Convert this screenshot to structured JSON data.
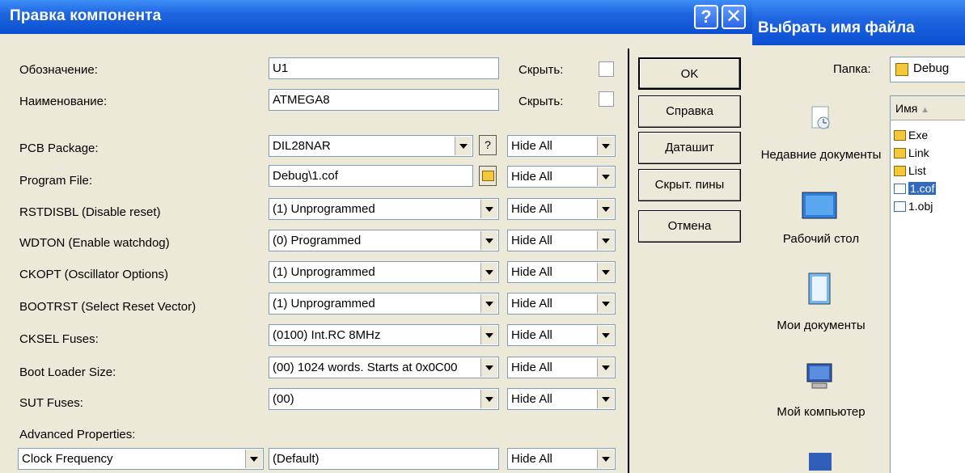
{
  "main_dialog": {
    "title": "Правка компонента",
    "help_button": "?",
    "close_button": "✕",
    "designation": {
      "label": "Обозначение:",
      "value": "U1",
      "hide_label": "Скрыть:"
    },
    "name": {
      "label": "Наименование:",
      "value": "ATMEGA8",
      "hide_label": "Скрыть:"
    },
    "properties": [
      {
        "label": "PCB Package:",
        "value": "DIL28NAR",
        "hide": "Hide All",
        "extra": "?"
      },
      {
        "label": "Program File:",
        "value": "Debug\\1.cof",
        "hide": "Hide All"
      },
      {
        "label": "RSTDISBL (Disable reset)",
        "value": "(1) Unprogrammed",
        "hide": "Hide All"
      },
      {
        "label": "WDTON (Enable watchdog)",
        "value": "(0) Programmed",
        "hide": "Hide All"
      },
      {
        "label": "CKOPT (Oscillator Options)",
        "value": "(1) Unprogrammed",
        "hide": "Hide All"
      },
      {
        "label": "BOOTRST (Select Reset Vector)",
        "value": "(1) Unprogrammed",
        "hide": "Hide All"
      },
      {
        "label": "CKSEL Fuses:",
        "value": "(0100) Int.RC 8MHz",
        "hide": "Hide All"
      },
      {
        "label": "Boot Loader Size:",
        "value": "(00) 1024 words. Starts at 0x0C00",
        "hide": "Hide All"
      },
      {
        "label": "SUT Fuses:",
        "value": "(00)",
        "hide": "Hide All"
      }
    ],
    "advanced": {
      "label": "Advanced Properties:",
      "property": "Clock Frequency",
      "value": "(Default)",
      "hide": "Hide All"
    },
    "buttons": {
      "ok": "OK",
      "help": "Справка",
      "datasheet": "Даташит",
      "hidden_pins": "Скрыт. пины",
      "cancel": "Отмена"
    }
  },
  "file_dialog": {
    "title": "Выбрать имя файла",
    "folder_label": "Папка:",
    "folder_value": "Debug",
    "places": [
      {
        "label": "Недавние документы",
        "icon": "recent-documents-icon"
      },
      {
        "label": "Рабочий стол",
        "icon": "desktop-icon"
      },
      {
        "label": "Мои документы",
        "icon": "my-documents-icon"
      },
      {
        "label": "Мой компьютер",
        "icon": "my-computer-icon"
      }
    ],
    "column_header": "Имя",
    "files": [
      {
        "name": "Exe",
        "type": "folder"
      },
      {
        "name": "Link",
        "type": "folder"
      },
      {
        "name": "List",
        "type": "folder"
      },
      {
        "name": "1.cof",
        "type": "file",
        "selected": true
      },
      {
        "name": "1.obj",
        "type": "file"
      }
    ]
  }
}
